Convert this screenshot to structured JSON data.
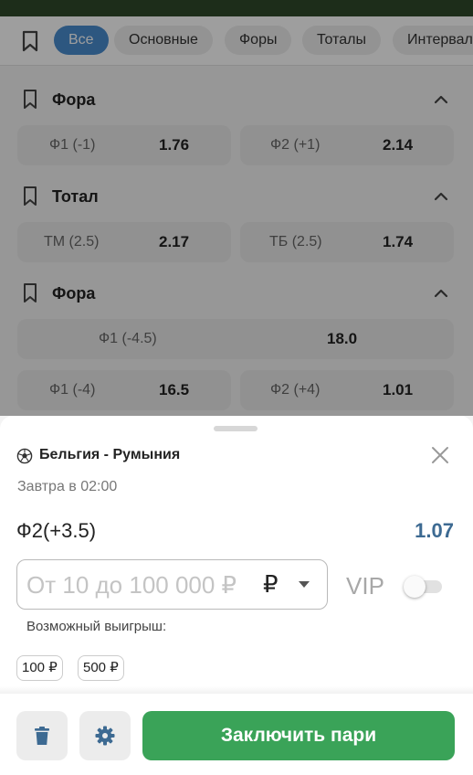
{
  "filters": {
    "chips": [
      "Все",
      "Основные",
      "Форы",
      "Тоталы",
      "Интервалы"
    ],
    "active_index": 0
  },
  "markets": [
    {
      "title": "Фора",
      "rows": [
        [
          {
            "label": "Ф1 (-1)",
            "value": "1.76"
          },
          {
            "label": "Ф2 (+1)",
            "value": "2.14"
          }
        ]
      ]
    },
    {
      "title": "Тотал",
      "rows": [
        [
          {
            "label": "ТМ (2.5)",
            "value": "2.17"
          },
          {
            "label": "ТБ (2.5)",
            "value": "1.74"
          }
        ]
      ]
    },
    {
      "title": "Фора",
      "rows": [
        [
          {
            "label": "Ф1 (-4.5)",
            "value": "18.0"
          }
        ],
        [
          {
            "label": "Ф1 (-4)",
            "value": "16.5"
          },
          {
            "label": "Ф2 (+4)",
            "value": "1.01"
          }
        ]
      ]
    }
  ],
  "betslip": {
    "match": "Бельгия - Румыния",
    "date": "Завтра в 02:00",
    "bet_name": "Ф2(+3.5)",
    "coefficient": "1.07",
    "stake_placeholder": "От 10 до 100 000 ₽",
    "currency": "₽",
    "vip_label": "VIP",
    "vip_enabled": false,
    "possible_win_label": "Возможный выигрыш:",
    "quick_stakes": [
      "100 ₽",
      "500 ₽"
    ],
    "submit_label": "Заключить пари"
  },
  "colors": {
    "accent_blue": "#4a8dcf",
    "coefficient": "#3d6a92",
    "submit_green": "#3aa358",
    "topbar_green": "#2f4a2b"
  },
  "icons": [
    "bookmark-icon",
    "chevron-up-icon",
    "soccer-ball-icon",
    "close-icon",
    "dropdown-caret-icon",
    "trash-icon",
    "gear-icon"
  ]
}
